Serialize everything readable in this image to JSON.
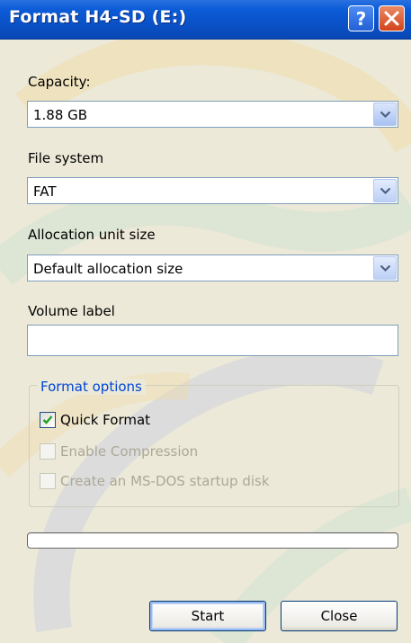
{
  "window": {
    "title": "Format H4-SD (E:)",
    "help_icon": "question-mark-icon",
    "close_icon": "close-x-icon"
  },
  "capacity": {
    "label": "Capacity:",
    "value": "1.88 GB"
  },
  "file_system": {
    "label": "File system",
    "value": "FAT"
  },
  "allocation": {
    "label": "Allocation unit size",
    "value": "Default allocation size"
  },
  "volume": {
    "label": "Volume label",
    "value": ""
  },
  "format_options": {
    "title": "Format options",
    "quick_format": {
      "label": "Quick Format",
      "checked": true,
      "enabled": true
    },
    "enable_compression": {
      "label": "Enable Compression",
      "checked": false,
      "enabled": false
    },
    "msdos_startup": {
      "label": "Create an MS-DOS startup disk",
      "checked": false,
      "enabled": false
    }
  },
  "progress": {
    "value": 0
  },
  "buttons": {
    "start": "Start",
    "close": "Close"
  },
  "colors": {
    "titlebar": "#0b5bd8",
    "window_bg": "#ece9d8",
    "group_title": "#0046d5",
    "disabled_text": "#aca899"
  }
}
